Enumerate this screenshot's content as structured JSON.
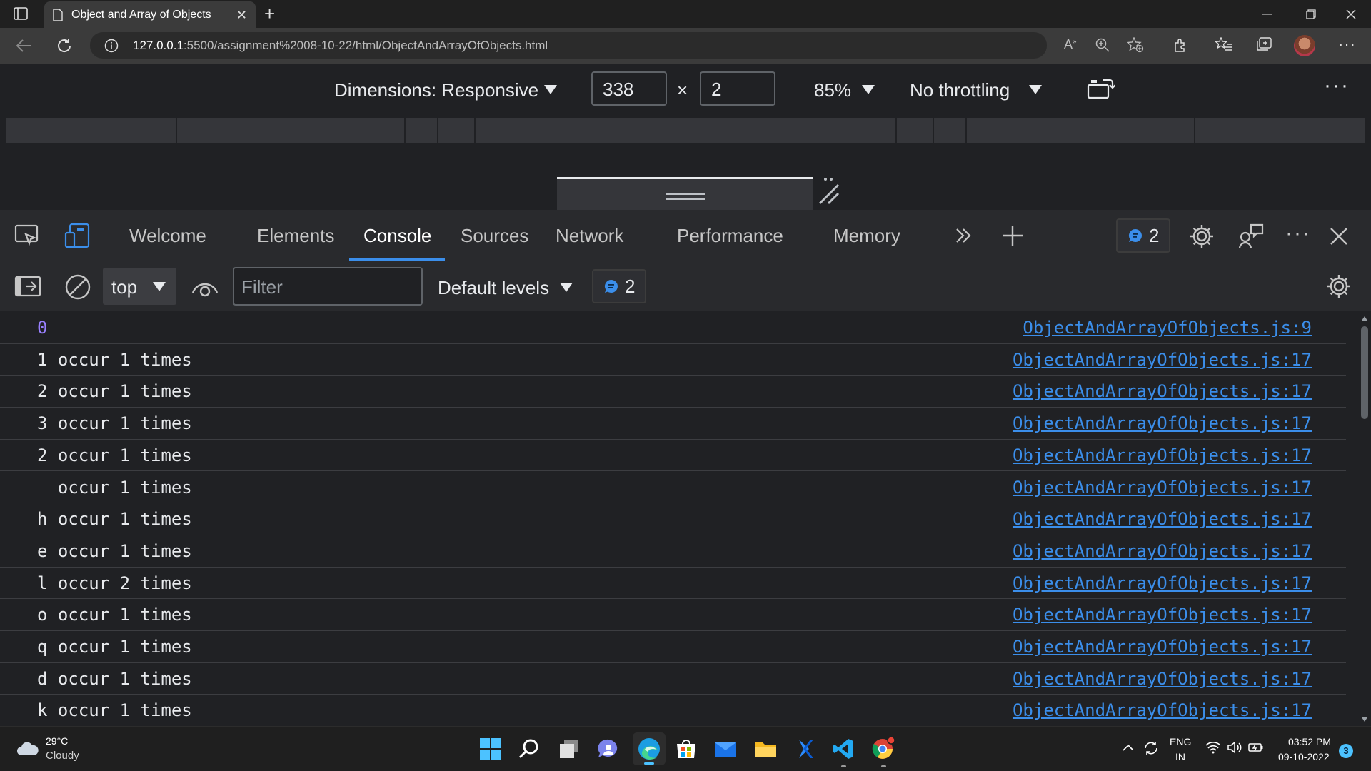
{
  "browser": {
    "tab_title": "Object and Array of Objects",
    "url_host": "127.0.0.1",
    "url_rest": ":5500/assignment%2008-10-22/html/ObjectAndArrayOfObjects.html"
  },
  "device_toolbar": {
    "dimensions_label": "Dimensions: Responsive",
    "width": "338",
    "times": "×",
    "height": "2",
    "zoom": "85%",
    "throttling": "No throttling"
  },
  "devtools": {
    "tabs": [
      "Welcome",
      "Elements",
      "Console",
      "Sources",
      "Network",
      "Performance",
      "Memory"
    ],
    "active_tab": "Console",
    "issues_count": "2"
  },
  "console_toolbar": {
    "context": "top",
    "filter_placeholder": "Filter",
    "levels": "Default levels",
    "messages_count": "2"
  },
  "console": {
    "rows": [
      {
        "text": "0",
        "source": "ObjectAndArrayOfObjects.js:9"
      },
      {
        "text": "1 occur 1 times",
        "source": "ObjectAndArrayOfObjects.js:17"
      },
      {
        "text": "2 occur 1 times",
        "source": "ObjectAndArrayOfObjects.js:17"
      },
      {
        "text": "3 occur 1 times",
        "source": "ObjectAndArrayOfObjects.js:17"
      },
      {
        "text": "2 occur 1 times",
        "source": "ObjectAndArrayOfObjects.js:17"
      },
      {
        "text": "  occur 1 times",
        "source": "ObjectAndArrayOfObjects.js:17"
      },
      {
        "text": "h occur 1 times",
        "source": "ObjectAndArrayOfObjects.js:17"
      },
      {
        "text": "e occur 1 times",
        "source": "ObjectAndArrayOfObjects.js:17"
      },
      {
        "text": "l occur 2 times",
        "source": "ObjectAndArrayOfObjects.js:17"
      },
      {
        "text": "o occur 1 times",
        "source": "ObjectAndArrayOfObjects.js:17"
      },
      {
        "text": "q occur 1 times",
        "source": "ObjectAndArrayOfObjects.js:17"
      },
      {
        "text": "d occur 1 times",
        "source": "ObjectAndArrayOfObjects.js:17"
      },
      {
        "text": "k occur 1 times",
        "source": "ObjectAndArrayOfObjects.js:17"
      }
    ]
  },
  "taskbar": {
    "temperature": "29°C",
    "weather": "Cloudy",
    "language": "ENG",
    "region": "IN",
    "time": "03:52 PM",
    "date": "09-10-2022",
    "notifications": "3"
  },
  "colors": {
    "accent": "#3b8eea",
    "number": "#9980ff"
  }
}
